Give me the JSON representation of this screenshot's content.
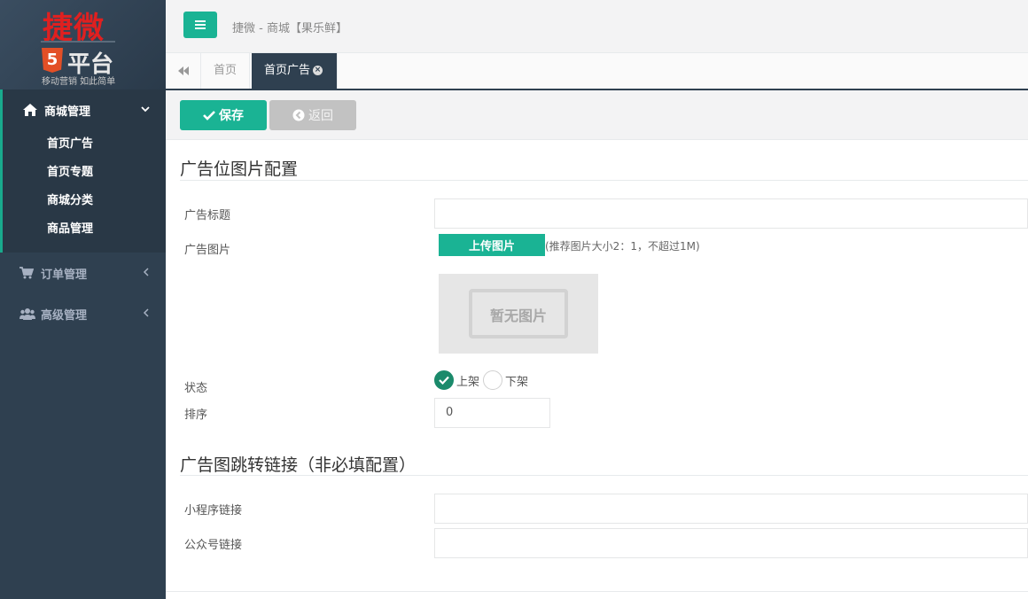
{
  "logo": {
    "main": "捷微",
    "badge": "5",
    "sub": "平台",
    "slogan": "移动营销 如此简单"
  },
  "sidebar": {
    "groups": [
      {
        "label": "商城管理",
        "items": [
          "首页广告",
          "首页专题",
          "商城分类",
          "商品管理"
        ]
      },
      {
        "label": "订单管理"
      },
      {
        "label": "高级管理"
      }
    ]
  },
  "header": {
    "title": "捷微 - 商城【果乐鲜】"
  },
  "tabs": [
    {
      "label": "首页"
    },
    {
      "label": "首页广告"
    }
  ],
  "toolbar": {
    "save_label": "保存",
    "back_label": "返回"
  },
  "form": {
    "section1_title": "广告位图片配置",
    "ad_title_label": "广告标题",
    "ad_title_value": "",
    "ad_image_label": "广告图片",
    "upload_label": "上传图片",
    "upload_hint": "(推荐图片大小2：1，不超过1M)",
    "no_image_text": "暂无图片",
    "status_label": "状态",
    "status_options": [
      "上架",
      "下架"
    ],
    "status_selected": "上架",
    "sort_label": "排序",
    "sort_value": "0",
    "section2_title": "广告图跳转链接（非必填配置）",
    "mini_link_label": "小程序链接",
    "mini_link_value": "",
    "mp_link_label": "公众号链接",
    "mp_link_value": ""
  },
  "colors": {
    "accent": "#1ab394",
    "sidebar_bg": "#2f4050",
    "checked_radio": "#1b8a6b"
  }
}
